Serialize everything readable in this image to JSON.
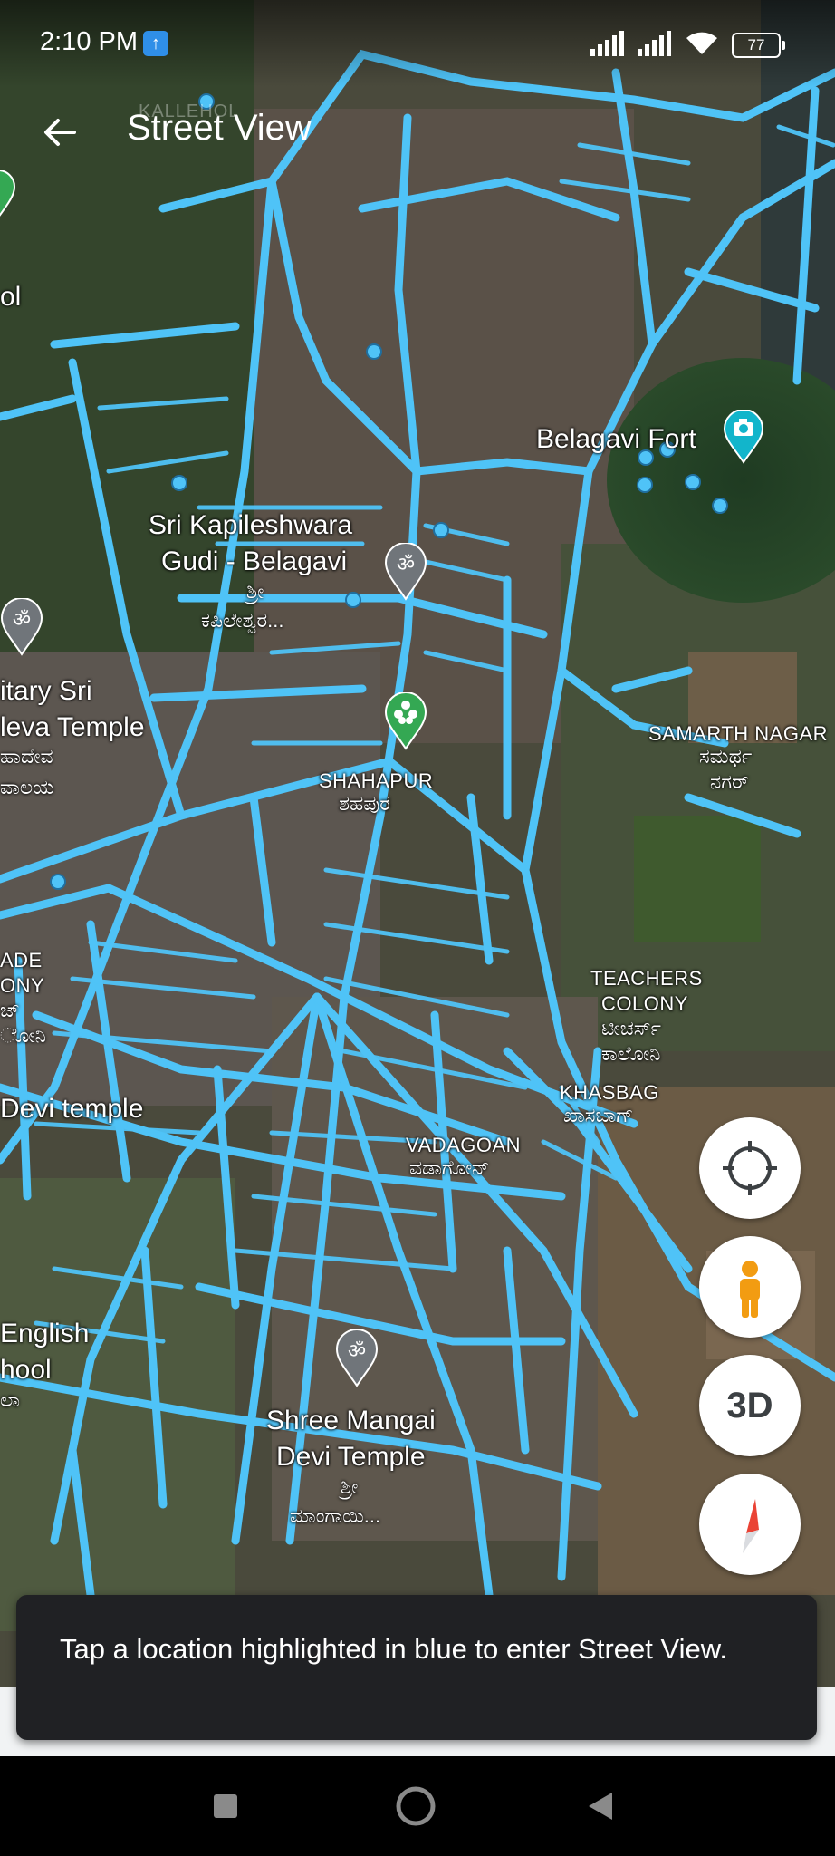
{
  "status_bar": {
    "time": "2:10 PM",
    "battery": "77"
  },
  "app_bar": {
    "title": "Street View",
    "faint_map_label": "KALLEHOL"
  },
  "map_labels": {
    "belagavi_fort": "Belagavi Fort",
    "kapileshwara_line1": "Sri Kapileshwara",
    "kapileshwara_line2": "Gudi - Belagavi",
    "kapileshwara_kn1": "ಶ್ರೀ",
    "kapileshwara_kn2": "ಕಪಿಲೇಶ್ವರ...",
    "samarth_nagar": "SAMARTH NAGAR",
    "samarth_nagar_kn1": "ಸಮರ್ಥ",
    "samarth_nagar_kn2": "ನಗರ್",
    "shahapur": "SHAHAPUR",
    "shahapur_kn": "ಶಹಪುರ",
    "military_line1": "itary Sri",
    "military_line2": "leva Temple",
    "military_kn1": "ಹಾದೇವ",
    "military_kn2": "ವಾಲಯ",
    "ade_line1": "ADE",
    "ade_line2": "ONY",
    "ade_kn1": "ಜ್",
    "ade_kn2": "ೋನಿ",
    "teachers_line1": "TEACHERS",
    "teachers_line2": "COLONY",
    "teachers_kn1": "ಟೀಚರ್ಸ್",
    "teachers_kn2": "ಕಾಲೋನಿ",
    "khasbag": "KHASBAG",
    "khasbag_kn": "ಖಾಸಬಾಗ್",
    "devi_temple": "Devi temple",
    "vadagoan": "VADAGOAN",
    "vadagoan_kn": "ವಡಾಗೋನ್",
    "english_line1": "English",
    "english_line2": "hool",
    "english_kn": "ಲಾ",
    "mangai_line1": "Shree Mangai",
    "mangai_line2": "Devi Temple",
    "mangai_kn1": "ಶ್ರೀ",
    "mangai_kn2": "ಮಾಂಗಾಯಿ...",
    "partial_l": "ol"
  },
  "controls": {
    "three_d_label": "3D"
  },
  "toast": {
    "message": "Tap a location highlighted in blue to enter Street View."
  },
  "colors": {
    "street_view_blue": "#4fc3f7",
    "pin_green": "#34a853",
    "pin_gray": "#70757a",
    "pegman_orange": "#f29c12"
  }
}
